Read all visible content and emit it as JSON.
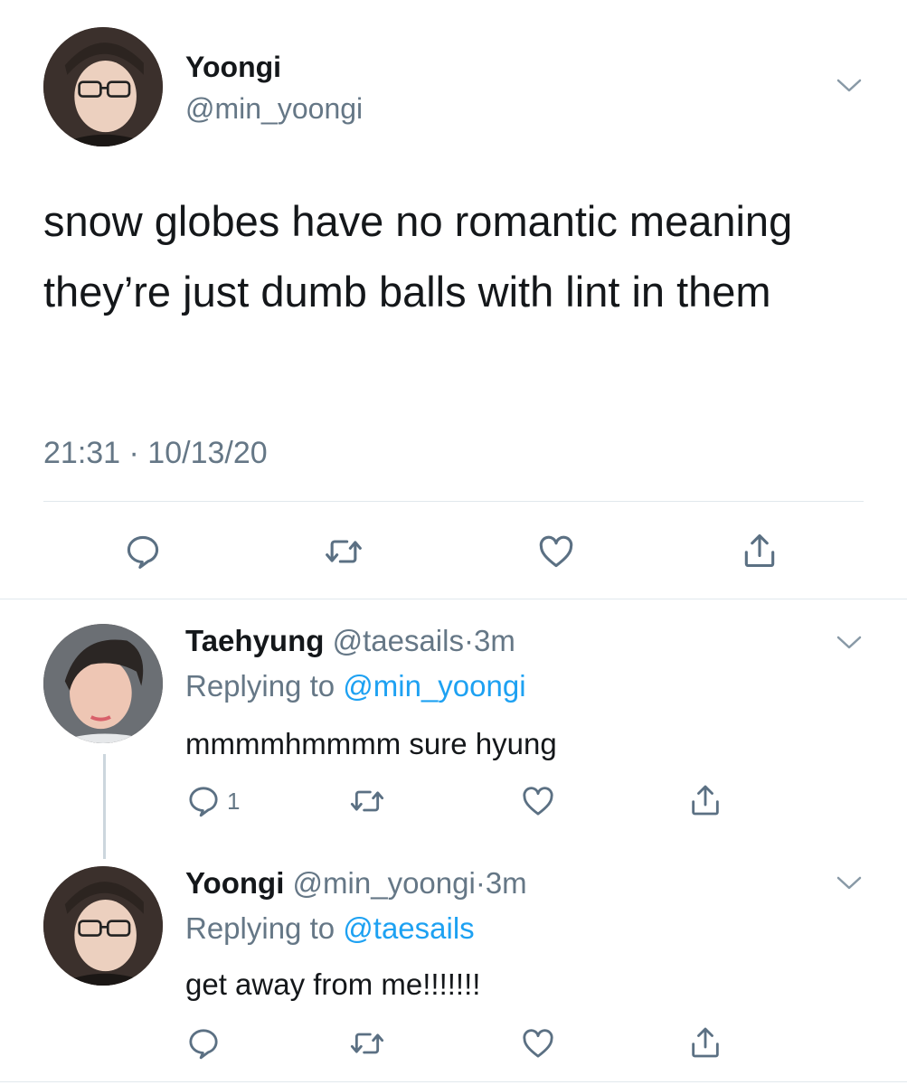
{
  "main_tweet": {
    "display_name": "Yoongi",
    "handle": "@min_yoongi",
    "text": "snow globes have no romantic meaning they’re just dumb balls with lint in them",
    "timestamp": "21:31 · 10/13/20"
  },
  "replies": [
    {
      "display_name": "Taehyung",
      "handle": "@taesails",
      "dot": "·",
      "time": "3m",
      "replying_label": "Replying to",
      "replying_to": "@min_yoongi",
      "text": "mmmmhmmmm sure hyung",
      "reply_count": "1"
    },
    {
      "display_name": "Yoongi",
      "handle": "@min_yoongi",
      "dot": "·",
      "time": "3m",
      "replying_label": "Replying to",
      "replying_to": "@taesails",
      "text": "get away from me!!!!!!!",
      "reply_count": ""
    }
  ],
  "icons": {
    "reply": "reply-icon",
    "retweet": "retweet-icon",
    "like": "heart-icon",
    "share": "share-icon",
    "more": "chevron-down-icon"
  },
  "colors": {
    "text": "#14171a",
    "muted": "#657786",
    "link": "#1da1f2",
    "icon": "#5b7083",
    "divider": "#e1e8ed"
  }
}
